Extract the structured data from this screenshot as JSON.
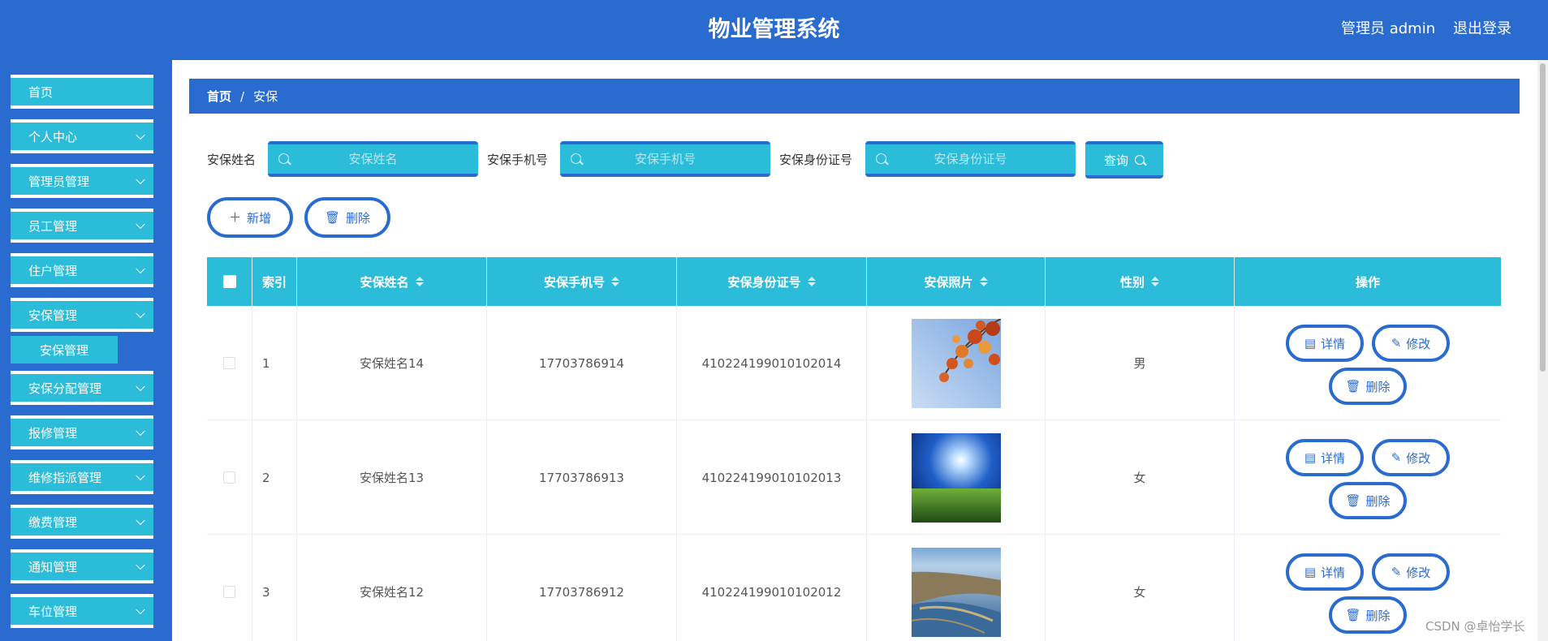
{
  "header": {
    "title": "物业管理系统",
    "user": "管理员 admin",
    "logout": "退出登录"
  },
  "sidebar": {
    "items": [
      {
        "label": "首页",
        "chevron": false
      },
      {
        "label": "个人中心",
        "chevron": true
      },
      {
        "label": "管理员管理",
        "chevron": true
      },
      {
        "label": "员工管理",
        "chevron": true
      },
      {
        "label": "住户管理",
        "chevron": true
      },
      {
        "label": "安保管理",
        "chevron": true
      },
      {
        "label": "安保分配管理",
        "chevron": true
      },
      {
        "label": "报修管理",
        "chevron": true
      },
      {
        "label": "维修指派管理",
        "chevron": true
      },
      {
        "label": "缴费管理",
        "chevron": true
      },
      {
        "label": "通知管理",
        "chevron": true
      },
      {
        "label": "车位管理",
        "chevron": true
      }
    ],
    "submenu_active": "安保管理"
  },
  "breadcrumb": {
    "home": "首页",
    "separator": "/",
    "current": "安保"
  },
  "search": {
    "name_label": "安保姓名",
    "name_placeholder": "安保姓名",
    "phone_label": "安保手机号",
    "phone_placeholder": "安保手机号",
    "id_label": "安保身份证号",
    "id_placeholder": "安保身份证号",
    "query_label": "查询"
  },
  "actions": {
    "add_label": "新增",
    "delete_label": "删除"
  },
  "table": {
    "headers": {
      "index": "索引",
      "name": "安保姓名",
      "phone": "安保手机号",
      "idcard": "安保身份证号",
      "photo": "安保照片",
      "gender": "性别",
      "ops": "操作"
    },
    "rows": [
      {
        "index": "1",
        "name": "安保姓名14",
        "phone": "17703786914",
        "idcard": "410224199010102014",
        "photo": "autumn-leaves",
        "gender": "男"
      },
      {
        "index": "2",
        "name": "安保姓名13",
        "phone": "17703786913",
        "idcard": "410224199010102013",
        "photo": "sun-over-field",
        "gender": "女"
      },
      {
        "index": "3",
        "name": "安保姓名12",
        "phone": "17703786912",
        "idcard": "410224199010102012",
        "photo": "coastline",
        "gender": "女"
      }
    ],
    "row_actions": {
      "detail": "详情",
      "edit": "修改",
      "delete": "删除"
    }
  },
  "watermark": "CSDN @卓怡学长",
  "colors": {
    "primary": "#2a6bd0",
    "accent": "#2bbcd9",
    "white": "#ffffff"
  }
}
